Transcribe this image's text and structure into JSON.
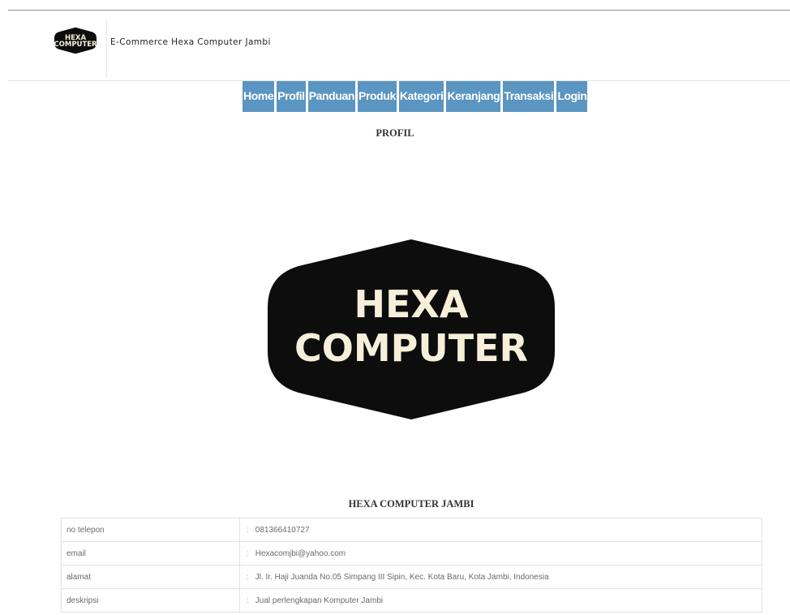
{
  "header": {
    "logo_text": [
      "HEXA",
      "COMPUTER"
    ],
    "title": "E-Commerce Hexa Computer Jambi"
  },
  "nav": {
    "items": [
      {
        "label": "Home"
      },
      {
        "label": "Profil"
      },
      {
        "label": "Panduan"
      },
      {
        "label": "Produk"
      },
      {
        "label": "Kategori"
      },
      {
        "label": "Keranjang"
      },
      {
        "label": "Transaksi"
      },
      {
        "label": "Login"
      }
    ]
  },
  "main": {
    "section_title": "PROFIL",
    "hero_logo_text": [
      "HEXA",
      "COMPUTER"
    ],
    "company_name": "HEXA COMPUTER JAMBI",
    "info_rows": [
      {
        "key": "no telepon",
        "sep": ":",
        "value": "081366410727"
      },
      {
        "key": "email",
        "sep": ":",
        "value": "Hexacomjbi@yahoo.com"
      },
      {
        "key": "alamat",
        "sep": ":",
        "value": "Jl. Ir. Haji Juanda No.05 Simpang III Sipin, Kec. Kota Baru, Kota Jambi, Indonesia"
      },
      {
        "key": "deskripsi",
        "sep": ":",
        "value": "Jual perlengkapan Komputer Jambi"
      }
    ]
  },
  "colors": {
    "nav_bg": "#5b95c1",
    "nav_text": "#ffffff",
    "logo_bg": "#0d0d0d",
    "logo_text": "#f6efd9"
  }
}
